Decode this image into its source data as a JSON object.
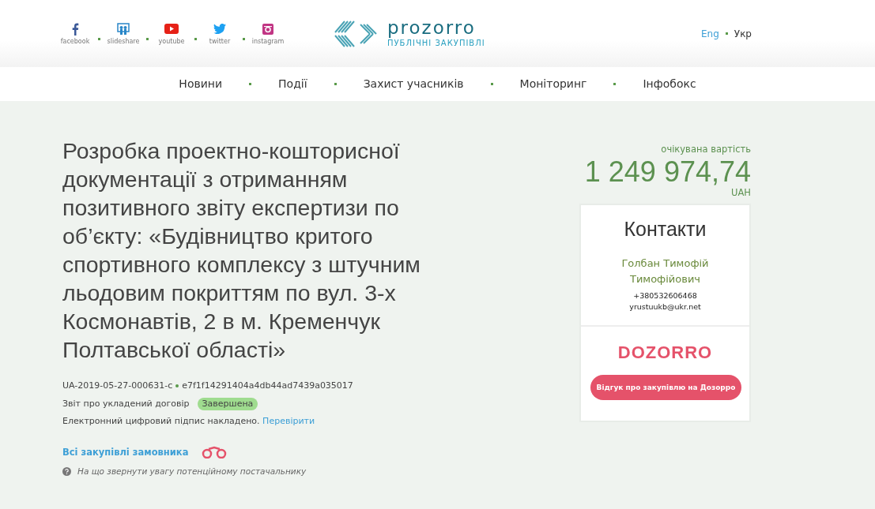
{
  "social": [
    {
      "kind": "facebook",
      "label": "facebook"
    },
    {
      "kind": "slideshare",
      "label": "slideshare"
    },
    {
      "kind": "youtube",
      "label": "youtube"
    },
    {
      "kind": "twitter",
      "label": "twitter"
    },
    {
      "kind": "instagram",
      "label": "instagram"
    }
  ],
  "logo": {
    "name": "prozorro",
    "tagline": "ПУБЛІЧНІ ЗАКУПІВЛІ"
  },
  "languages": [
    {
      "label": "Eng",
      "selected": false
    },
    {
      "label": "Укр",
      "selected": true
    }
  ],
  "nav": [
    "Новини",
    "Події",
    "Захист учасників",
    "Моніторинг",
    "Інфобокс"
  ],
  "tender": {
    "title": "Розробка проектно-кошторисної документації з отриманням позитивного звіту експертизи по об’єкту: «Будівництво критого спортивного комплексу з штучним льодовим покриттям по вул. 3-х Космонавтів, 2 в м. Кременчук Полтавської області»",
    "id": "UA-2019-05-27-000631-c",
    "hash": "e7f1f14291404a4db44ad7439a035017",
    "type": "Звіт про укладений договір",
    "status": "Завершена",
    "signature": "Електронний цифровий підпис накладено.",
    "verify_link": "Перевірити",
    "all_link": "Всі закупівлі замовника",
    "hint": "На що звернути увагу потенційному постачальнику"
  },
  "value": {
    "label": "очікувана вартість",
    "amount": "1 249 974,74",
    "currency": "UAH"
  },
  "contacts": {
    "title": "Контакти",
    "name": "Голбан Тимофій Тимофійович",
    "phone": "+380532606468",
    "email": "yrustuukb@ukr.net"
  },
  "dozorro": {
    "logo": "DOZORRO",
    "button": "Відгук про закупівлю на Дозорро"
  }
}
